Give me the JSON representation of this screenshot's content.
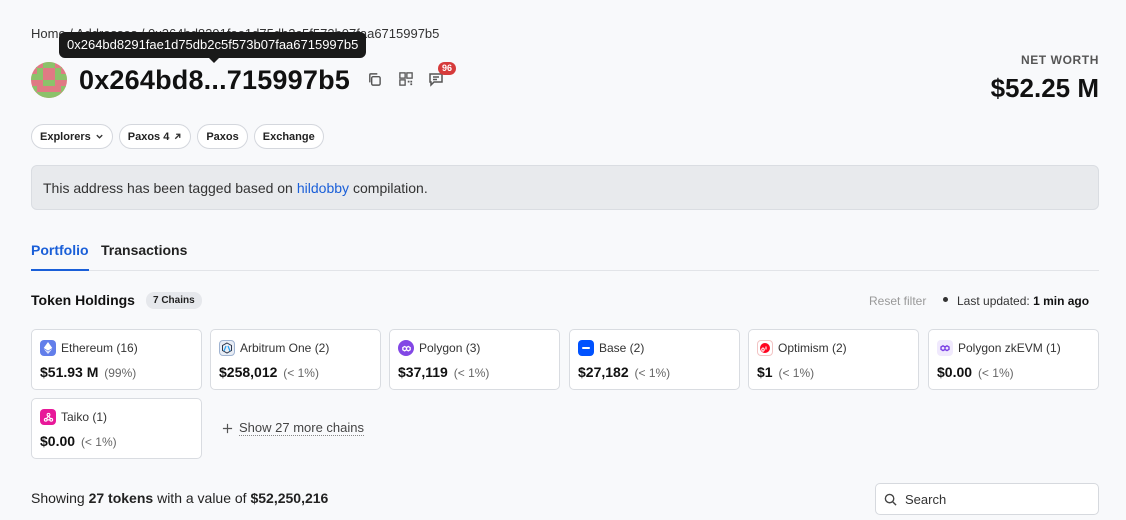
{
  "breadcrumb": "Home / Addresses / 0x264bd8291fae1d75db2c5f573b07faa6715997b5",
  "tooltip": "0x264bd8291fae1d75db2c5f573b07faa6715997b5",
  "address_short": "0x264bd8...715997b5",
  "comments_count": "96",
  "net_worth": {
    "label": "NET WORTH",
    "value": "$52.25 M"
  },
  "tags": [
    {
      "label": "Explorers",
      "icon": "chevron-down-icon"
    },
    {
      "label": "Paxos 4",
      "icon": "external-arrow-icon"
    },
    {
      "label": "Paxos"
    },
    {
      "label": "Exchange"
    }
  ],
  "notice": {
    "before": "This address has been tagged based on",
    "link": "hildobby",
    "after": "compilation."
  },
  "tabs": [
    {
      "label": "Portfolio"
    },
    {
      "label": "Transactions"
    }
  ],
  "holdings": {
    "title": "Token Holdings",
    "chains_count": "7 Chains",
    "reset": "Reset filter",
    "last_updated_label": "Last updated:",
    "last_updated_value": "1 min ago",
    "show_more": "Show 27 more chains"
  },
  "chains": [
    {
      "name": "Ethereum (16)",
      "value": "$51.93 M",
      "pct": "(99%)",
      "color": "#627eea",
      "icon": "ethereum-icon"
    },
    {
      "name": "Arbitrum One (2)",
      "value": "$258,012",
      "pct": "(< 1%)",
      "color": "#2d374b",
      "icon": "arbitrum-icon"
    },
    {
      "name": "Polygon (3)",
      "value": "$37,119",
      "pct": "(< 1%)",
      "color": "#8247e5",
      "icon": "polygon-icon"
    },
    {
      "name": "Base (2)",
      "value": "$27,182",
      "pct": "(< 1%)",
      "color": "#0052ff",
      "icon": "base-icon"
    },
    {
      "name": "Optimism (2)",
      "value": "$1",
      "pct": "(< 1%)",
      "color": "#ff0420",
      "icon": "optimism-icon"
    },
    {
      "name": "Polygon zkEVM (1)",
      "value": "$0.00",
      "pct": "(< 1%)",
      "color": "#7b3fe4",
      "icon": "polygon-zkevm-icon"
    },
    {
      "name": "Taiko (1)",
      "value": "$0.00",
      "pct": "(< 1%)",
      "color": "#e81899",
      "icon": "taiko-icon"
    }
  ],
  "summary": {
    "prefix": "Showing",
    "count": "27 tokens",
    "middle": "with a value of",
    "value": "$52,250,216"
  },
  "search": {
    "placeholder": "Search"
  }
}
